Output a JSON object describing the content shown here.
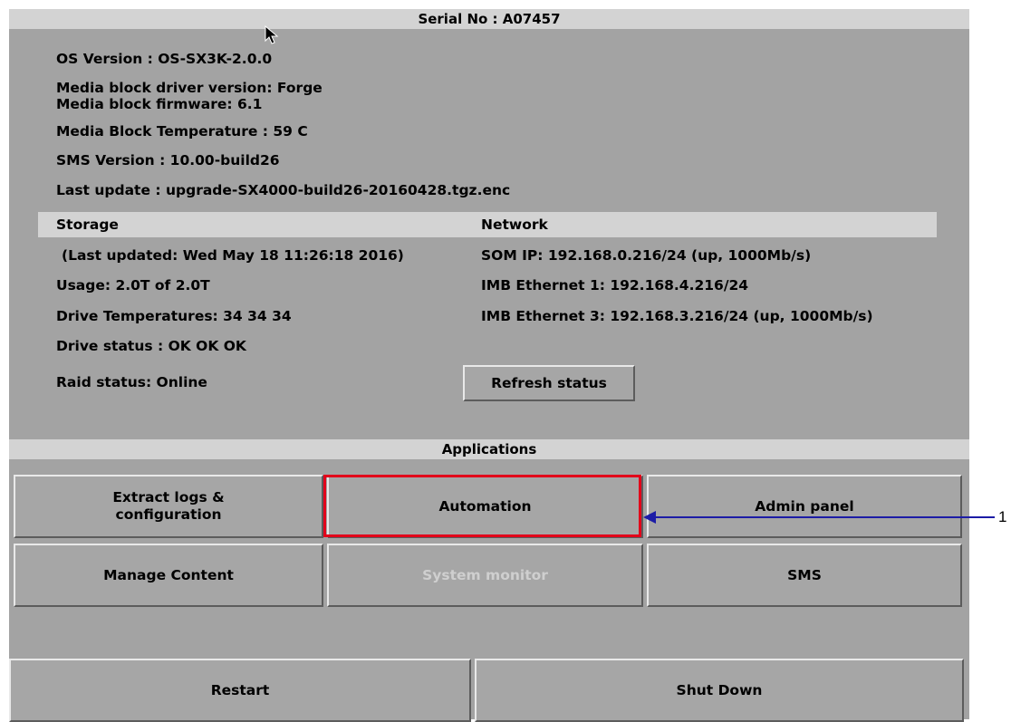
{
  "header": {
    "serial": "Serial No : A07457"
  },
  "info": {
    "os_version": "OS Version : OS-SX3K-2.0.0",
    "driver_version": "Media block driver version: Forge",
    "firmware": "Media block firmware: 6.1",
    "temperature": "Media Block Temperature : 59 C",
    "sms_version": "SMS Version : 10.00-build26",
    "last_update": "Last update : upgrade-SX4000-build26-20160428.tgz.enc"
  },
  "storage": {
    "title": "Storage",
    "last_updated": "(Last updated: Wed May 18 11:26:18 2016)",
    "usage": "Usage: 2.0T of 2.0T",
    "drive_temps": "Drive Temperatures: 34 34 34",
    "drive_status": "Drive status : OK OK OK",
    "raid_status": "Raid status: Online"
  },
  "network": {
    "title": "Network",
    "som_ip": "SOM IP: 192.168.0.216/24 (up, 1000Mb/s)",
    "imb_eth1": "IMB Ethernet 1: 192.168.4.216/24",
    "imb_eth3": "IMB Ethernet 3: 192.168.3.216/24 (up, 1000Mb/s)"
  },
  "refresh_label": "Refresh status",
  "applications": {
    "title": "Applications",
    "extract_logs_line1": "Extract logs &",
    "extract_logs_line2": "configuration",
    "automation": "Automation",
    "admin_panel": "Admin panel",
    "manage_content": "Manage Content",
    "system_monitor": "System monitor",
    "sms": "SMS"
  },
  "power": {
    "restart": "Restart",
    "shutdown": "Shut Down"
  },
  "callout": {
    "number": "1",
    "color": "#1c1ca6",
    "highlight_color": "#e2001a"
  },
  "icons": {
    "cursor": "mouse-pointer-icon"
  }
}
